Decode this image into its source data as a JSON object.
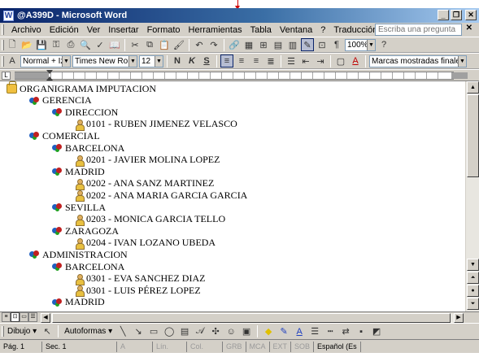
{
  "window": {
    "title": "@A399D - Microsoft Word",
    "app_letter": "W"
  },
  "menu": {
    "items": [
      "Archivo",
      "Edición",
      "Ver",
      "Insertar",
      "Formato",
      "Herramientas",
      "Tabla",
      "Ventana",
      "?",
      "Traducción"
    ],
    "help_placeholder": "Escriba una pregunta"
  },
  "standard_toolbar": {
    "zoom": "100%"
  },
  "format_toolbar": {
    "style": "Normal + Izquie",
    "font": "Times New Roman",
    "size": "12",
    "bold": "N",
    "italic": "K",
    "underline": "S",
    "markup_view": "Marcas mostradas finales"
  },
  "tree": [
    {
      "level": 0,
      "type": "org",
      "text": "ORGANIGRAMA IMPUTACION"
    },
    {
      "level": 1,
      "type": "group",
      "text": "GERENCIA"
    },
    {
      "level": 2,
      "type": "group",
      "text": "DIRECCION"
    },
    {
      "level": 3,
      "type": "user",
      "text": "0101 - RUBEN JIMENEZ VELASCO"
    },
    {
      "level": 1,
      "type": "group",
      "text": "COMERCIAL"
    },
    {
      "level": 2,
      "type": "group",
      "text": "BARCELONA"
    },
    {
      "level": 3,
      "type": "user",
      "text": "0201 - JAVIER MOLINA LOPEZ"
    },
    {
      "level": 2,
      "type": "group",
      "text": "MADRID"
    },
    {
      "level": 3,
      "type": "user",
      "text": "0202 - ANA SANZ MARTINEZ"
    },
    {
      "level": 3,
      "type": "user",
      "text": "0202 - ANA MARIA GARCIA GARCIA"
    },
    {
      "level": 2,
      "type": "group",
      "text": "SEVILLA"
    },
    {
      "level": 3,
      "type": "user",
      "text": "0203 - MONICA GARCIA TELLO"
    },
    {
      "level": 2,
      "type": "group",
      "text": "ZARAGOZA"
    },
    {
      "level": 3,
      "type": "user",
      "text": "0204 - IVAN LOZANO UBEDA"
    },
    {
      "level": 1,
      "type": "group",
      "text": "ADMINISTRACION"
    },
    {
      "level": 2,
      "type": "group",
      "text": "BARCELONA"
    },
    {
      "level": 3,
      "type": "user",
      "text": "0301 - EVA SANCHEZ DIAZ"
    },
    {
      "level": 3,
      "type": "user",
      "text": "0301 - LUIS PÉREZ LOPEZ"
    },
    {
      "level": 2,
      "type": "group",
      "text": "MADRID"
    }
  ],
  "drawing_toolbar": {
    "draw_label": "Dibujo",
    "autoshapes_label": "Autoformas"
  },
  "status": {
    "page": "Pág.  1",
    "section": "Sec.  1",
    "frac": "A",
    "line": "Lín.",
    "col": "Col.",
    "rec": "GRB",
    "trk": "MCA",
    "ext": "EXT",
    "ovr": "SOB",
    "language": "Español (Es"
  },
  "colors": {
    "title_start": "#0a246a",
    "title_end": "#a6caf0",
    "chrome": "#d4d0c8",
    "annotation_arrow": "#d00000"
  }
}
